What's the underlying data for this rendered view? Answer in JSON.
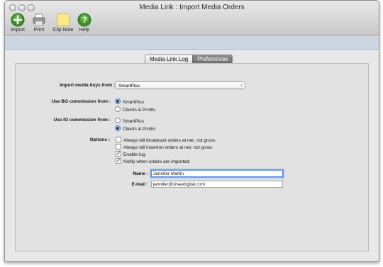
{
  "window": {
    "title": "Media Link : Import Media Orders"
  },
  "toolbar": {
    "import_label": "Import",
    "print_label": "Print",
    "clip_note_label": "Clip Note",
    "help_label": "Help"
  },
  "tabs": {
    "log_label": "Media Link Log",
    "preferences_label": "Preferences",
    "active": "Preferences"
  },
  "preferences": {
    "import_from_label": "Import media buys from :",
    "import_from_value": "SmartPlus",
    "bo_label": "Use BO commission from :",
    "bo_options": [
      "SmartPlus",
      "Clients & Profits"
    ],
    "bo_selected": "SmartPlus",
    "io_label": "Use IO commission from :",
    "io_options": [
      "SmartPlus",
      "Clients & Profits"
    ],
    "io_selected": "Clients & Profits",
    "options_label": "Options :",
    "options": [
      {
        "label": "Always bill broadcast orders at net, not gross",
        "checked": false
      },
      {
        "label": "Always bill insertion orders at net, not gross",
        "checked": false
      },
      {
        "label": "Enable log",
        "checked": true
      },
      {
        "label": "Notify when orders are imported:",
        "checked": true
      }
    ],
    "name_label": "Name :",
    "name_value": "Jennifer Martin",
    "email_label": "E-mail :",
    "email_value": "jennifer@shaedigital.com"
  }
}
